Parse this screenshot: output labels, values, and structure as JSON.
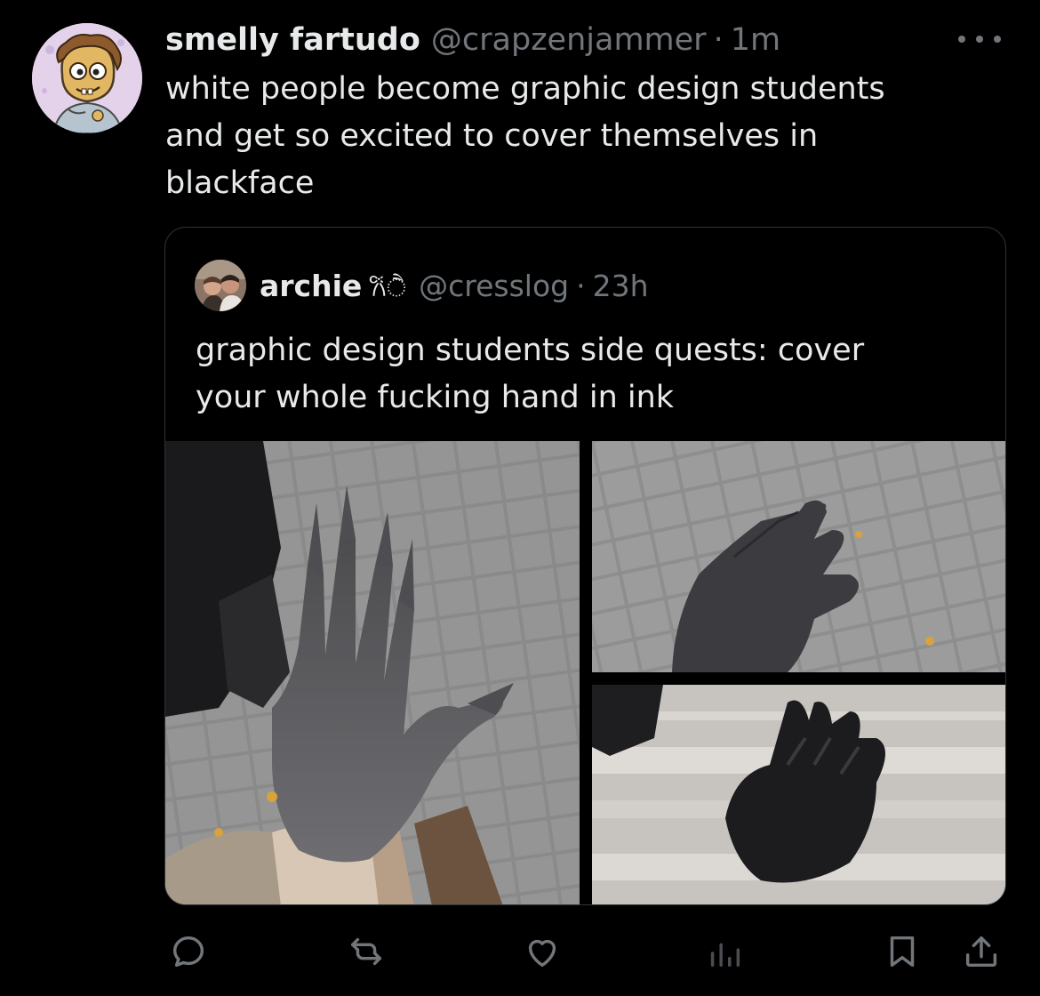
{
  "post": {
    "author_name": "smelly fartudo",
    "author_handle": "@crapzenjammer",
    "separator": "·",
    "timestamp": "1m",
    "text": "white people become graphic design students\nand get so excited to cover themselves in\nblackface"
  },
  "quoted_post": {
    "author_name": "archie",
    "author_emoji": "𐙚ੈ",
    "author_handle": "@cresslog",
    "separator": "·",
    "timestamp": "23h",
    "text": "graphic design students side quests: cover\nyour whole fucking hand in ink",
    "media": [
      {
        "alt": "ink-covered hand with long pointed black nails held over grey paving stones"
      },
      {
        "alt": "ink-covered hand with long nails over paving stones"
      },
      {
        "alt": "ink-covered hand with curled fingers over white tiled steps"
      }
    ]
  },
  "actions": {
    "reply_icon": "reply-icon",
    "repost_icon": "repost-icon",
    "like_icon": "like-icon",
    "views_icon": "views-icon",
    "bookmark_icon": "bookmark-icon",
    "share_icon": "share-icon"
  },
  "colors": {
    "background": "#000000",
    "text_primary": "#e7e9ea",
    "text_secondary": "#71767b",
    "border": "#2f3336"
  }
}
